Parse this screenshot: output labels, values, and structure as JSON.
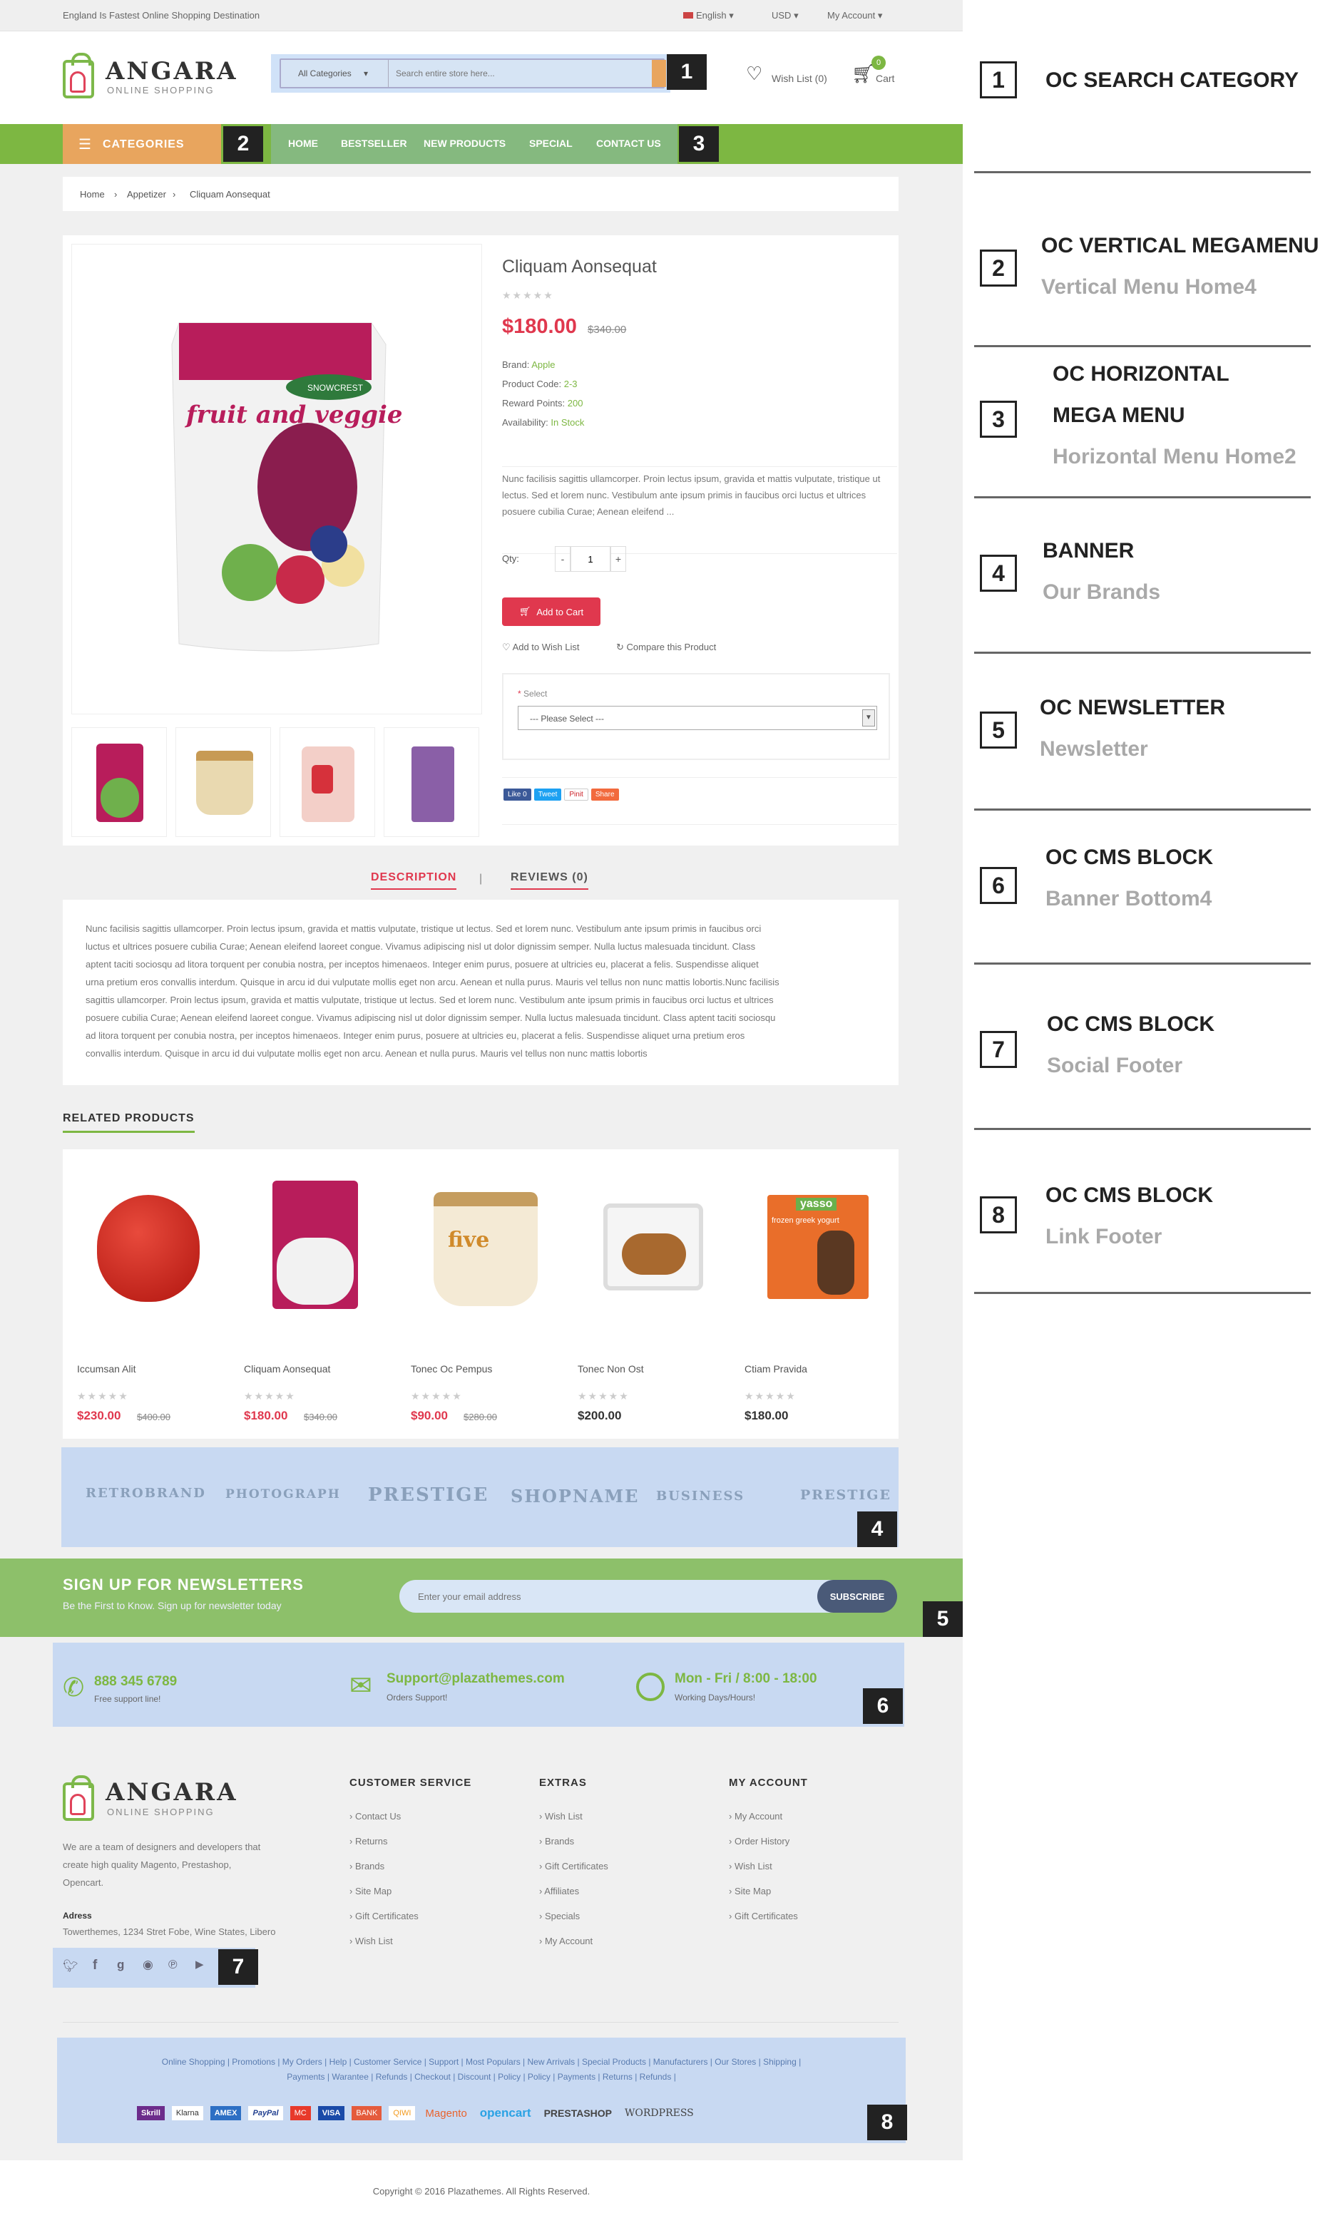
{
  "topbar": {
    "tagline": "England Is Fastest Online Shopping Destination",
    "language": "English",
    "currency": "USD",
    "account": "My Account"
  },
  "header": {
    "logo_name": "ANGARA",
    "logo_sub": "ONLINE SHOPPING",
    "category_select": "All Categories",
    "search_placeholder": "Search entire store here...",
    "wishlist": "Wish List (0)",
    "cart_count": "0",
    "cart_label": "Cart"
  },
  "nav": {
    "categories_label": "CATEGORIES",
    "items": [
      "HOME",
      "BESTSELLER",
      "NEW PRODUCTS",
      "SPECIAL",
      "CONTACT US"
    ]
  },
  "breadcrumb": [
    "Home",
    "Appetizer",
    "Cliquam Aonsequat"
  ],
  "product": {
    "title": "Cliquam Aonsequat",
    "price": "$180.00",
    "old_price": "$340.00",
    "brand_label": "Brand:",
    "brand": "Apple",
    "code_label": "Product Code:",
    "code": "2-3",
    "points_label": "Reward Points:",
    "points": "200",
    "avail_label": "Availability:",
    "avail": "In Stock",
    "desc_short": "Nunc facilisis sagittis ullamcorper. Proin lectus ipsum, gravida et mattis vulputate, tristique ut lectus. Sed et lorem nunc. Vestibulum ante ipsum primis in faucibus orci luctus et ultrices posuere cubilia Curae; Aenean eleifend ...",
    "qty_label": "Qty:",
    "qty_value": "1",
    "minus": "-",
    "plus": "+",
    "add_to_cart": "Add to Cart",
    "wishlist": "Add to Wish List",
    "compare": "Compare this Product",
    "select_label": "Select",
    "select_value": "--- Please Select ---",
    "share": [
      "Like 0",
      "Tweet",
      "Pinit",
      "Share"
    ],
    "image_texts": [
      "fruit and veggie",
      "SNOWCREST"
    ]
  },
  "tabs": {
    "description": "DESCRIPTION",
    "reviews": "REVIEWS (0)"
  },
  "description_lines": [
    "Nunc facilisis sagittis ullamcorper. Proin lectus ipsum, gravida et mattis vulputate, tristique ut lectus. Sed et lorem nunc. Vestibulum ante ipsum primis in faucibus orci",
    "luctus et ultrices posuere cubilia Curae; Aenean eleifend laoreet congue. Vivamus adipiscing nisl ut dolor dignissim semper. Nulla luctus malesuada tincidunt. Class",
    "aptent taciti sociosqu ad litora torquent per conubia nostra, per inceptos himenaeos. Integer enim purus, posuere at ultricies eu, placerat a felis. Suspendisse aliquet",
    "urna pretium eros convallis interdum. Quisque in arcu id dui vulputate mollis eget non arcu. Aenean et nulla purus. Mauris vel tellus non nunc mattis lobortis.Nunc facilisis",
    "sagittis ullamcorper. Proin lectus ipsum, gravida et mattis vulputate, tristique ut lectus. Sed et lorem nunc. Vestibulum ante ipsum primis in faucibus orci luctus et ultrices",
    "posuere cubilia Curae; Aenean eleifend laoreet congue. Vivamus adipiscing nisl ut dolor dignissim semper. Nulla luctus malesuada tincidunt. Class aptent taciti sociosqu",
    "ad litora torquent per conubia nostra, per inceptos himenaeos. Integer enim purus, posuere at ultricies eu, placerat a felis. Suspendisse aliquet urna pretium eros",
    "convallis interdum. Quisque in arcu id dui vulputate mollis eget non arcu. Aenean et nulla purus. Mauris vel tellus non nunc mattis lobortis"
  ],
  "related": {
    "title": "RELATED PRODUCTS",
    "items": [
      {
        "name": "Iccumsan Alit",
        "price": "$230.00",
        "old": "$400.00"
      },
      {
        "name": "Cliquam Aonsequat",
        "price": "$180.00",
        "old": "$340.00"
      },
      {
        "name": "Tonec Oc Pempus",
        "price": "$90.00",
        "old": "$280.00"
      },
      {
        "name": "Tonec Non Ost",
        "price": "$200.00",
        "old": ""
      },
      {
        "name": "Ctiam Pravida",
        "price": "$180.00",
        "old": ""
      }
    ],
    "image_texts": [
      "five",
      "yasso",
      "frozen greek yogurt"
    ]
  },
  "brands": [
    "RETROBRAND",
    "PHOTOGRAPH",
    "PRESTIGE",
    "SHOPNAME",
    "BUSINESS",
    "PRESTIGE"
  ],
  "newsletter": {
    "title": "SIGN UP FOR NEWSLETTERS",
    "subtitle": "Be the First to Know. Sign up for newsletter today",
    "placeholder": "Enter your email address",
    "button": "SUBSCRIBE"
  },
  "contact": [
    {
      "main": "888 345 6789",
      "sub": "Free support line!"
    },
    {
      "main": "Support@plazathemes.com",
      "sub": "Orders Support!"
    },
    {
      "main": "Mon - Fri / 8:00 - 18:00",
      "sub": "Working Days/Hours!"
    }
  ],
  "footer": {
    "about": [
      "We are a team of designers and developers that",
      "create high quality Magento, Prestashop,",
      "Opencart."
    ],
    "address_label": "Adress",
    "address": "Towerthemes, 1234 Stret Fobe, Wine States, Libero",
    "columns": [
      {
        "title": "CUSTOMER SERVICE",
        "links": [
          "Contact Us",
          "Returns",
          "Brands",
          "Site Map",
          "Gift Certificates",
          "Wish List"
        ]
      },
      {
        "title": "EXTRAS",
        "links": [
          "Wish List",
          "Brands",
          "Gift Certificates",
          "Affiliates",
          "Specials",
          "My Account"
        ]
      },
      {
        "title": "MY ACCOUNT",
        "links": [
          "My Account",
          "Order History",
          "Wish List",
          "Site Map",
          "Gift Certificates"
        ]
      }
    ],
    "links_row1": "Online Shopping | Promotions | My Orders | Help | Customer Service | Support | Most Populars | New Arrivals | Special Products | Manufacturers | Our Stores | Shipping |",
    "links_row2": "Payments | Warantee | Refunds | Checkout | Discount | Policy | Policy | Payments | Returns | Refunds |",
    "payments": [
      "Skrill",
      "Klarna",
      "AMEX",
      "PayPal",
      "MC",
      "VISA",
      "BANK",
      "QIWI",
      "Magento",
      "opencart",
      "PRESTASHOP",
      "WORDPRESS"
    ],
    "copyright": "Copyright © 2016 Plazathemes. All Rights Reserved."
  },
  "markers": [
    "1",
    "2",
    "3",
    "4",
    "5",
    "6",
    "7",
    "8"
  ],
  "annotations": [
    {
      "num": "1",
      "title": "OC SEARCH CATEGORY",
      "sub": ""
    },
    {
      "num": "2",
      "title": "OC VERTICAL MEGAMENU",
      "sub": "Vertical Menu Home4"
    },
    {
      "num": "3",
      "title": "OC HORIZONTAL",
      "title2": "MEGA MENU",
      "sub": "Horizontal Menu Home2"
    },
    {
      "num": "4",
      "title": "BANNER",
      "sub": "Our Brands"
    },
    {
      "num": "5",
      "title": "OC NEWSLETTER",
      "sub": "Newsletter"
    },
    {
      "num": "6",
      "title": "OC CMS BLOCK",
      "sub": "Banner Bottom4"
    },
    {
      "num": "7",
      "title": "OC CMS BLOCK",
      "sub": "Social Footer"
    },
    {
      "num": "8",
      "title": "OC CMS BLOCK",
      "sub": "Link Footer"
    }
  ],
  "colors": {
    "green": "#7db742",
    "red": "#e0384e",
    "orange": "#e8a55e",
    "highlight": "#c7d9f2"
  }
}
